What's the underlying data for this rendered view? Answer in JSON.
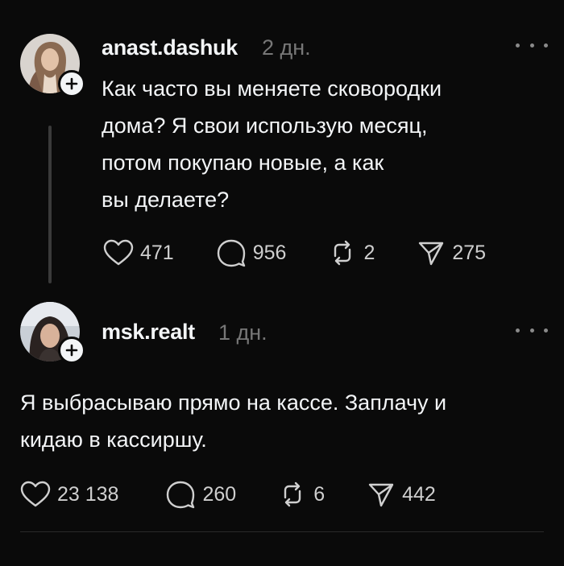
{
  "posts": [
    {
      "username": "anast.dashuk",
      "time": "2 дн.",
      "text": "Как часто вы меняете сковородки\nдома? Я свои использую месяц,\nпотом покупаю новые, а как\nвы делаете?",
      "likes": "471",
      "replies": "956",
      "reposts": "2",
      "shares": "275"
    },
    {
      "username": "msk.realt",
      "time": "1 дн.",
      "text": "Я выбрасываю прямо на кассе. Заплачу и\nкидаю в кассиршу.",
      "likes": "23 138",
      "replies": "260",
      "reposts": "6",
      "shares": "442"
    }
  ],
  "icons": {
    "like": "heart-icon",
    "reply": "comment-icon",
    "repost": "repost-icon",
    "share": "send-icon",
    "follow": "plus-icon",
    "more": "more-icon"
  },
  "colors": {
    "background": "#0a0a0a",
    "text": "#f3f5f7",
    "muted": "#777777"
  }
}
